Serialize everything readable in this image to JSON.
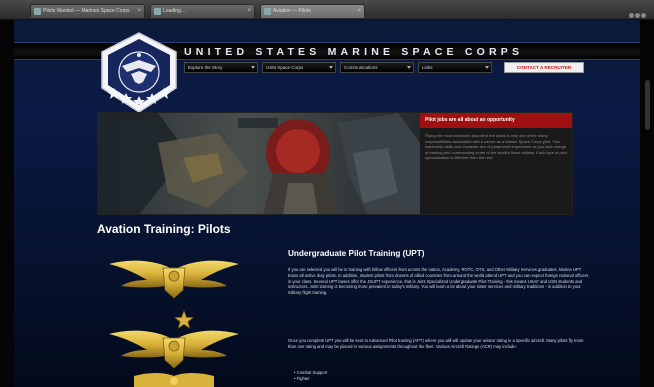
{
  "browser": {
    "tabs": [
      {
        "label": "Pilots Wanted — Marines Space Corps"
      },
      {
        "label": "Loading…"
      },
      {
        "label": "Aviation — Pilots"
      }
    ]
  },
  "site": {
    "title": "UNITED STATES MARINE SPACE CORPS",
    "nav": [
      {
        "label": "Explore the Story"
      },
      {
        "label": "USM Space Corps"
      },
      {
        "label": "Communications"
      },
      {
        "label": "Links"
      }
    ],
    "contact_label": "CONTACT A RECRUITER"
  },
  "hero": {
    "panel_title": "Pilot jobs are all about an opportunity",
    "panel_text": "Flying the most advanced aircraft in the world is only one of the many responsibilities associated with a career as a Marine Space Corps pilot. Your leadership skills and character are of paramount importance as you take charge of training and commanding some of the world's finest military. Each type of pilot specialization is different from the rest."
  },
  "page": {
    "heading": "Avation Training: Pilots"
  },
  "article": {
    "title": "Undergraduate Pilot Training (UPT)",
    "p1": "If you are selected you will be in training with fellow officers from across the nation, Academy, ROTC, OTS, and Other Military Services graduates. Marine UPT trains all active duty pilots. In addition, student pilots from dozens of allied countries from around the world attend UPT and you can expect foreign national officers in your class. Several UPT bases offer the JSUPT experience, that is Joint Specialized Undergraduate Pilot Training - this means USAF and USN students and instructors. Joint training is becoming more prevalent in today's military. You will learn a lot about your sister services and military traditions - in addition to your military flight training.",
    "p2": "Once you complete UPT you will be sent to Advanced Pilot training (APT) where you will will update your aviator rating in a specific aircraft. Many pilots fly more than one rating and may be placed in various assignments throughout the fleet. Various Aircraft Ratings (ACR) may include:",
    "list": [
      "Combat Support",
      "Fighter"
    ]
  },
  "colors": {
    "page_top": "#0c1a3a",
    "page_bottom": "#030a1c",
    "accent_red": "#a01010",
    "wing_gold": "#d8b23a"
  }
}
